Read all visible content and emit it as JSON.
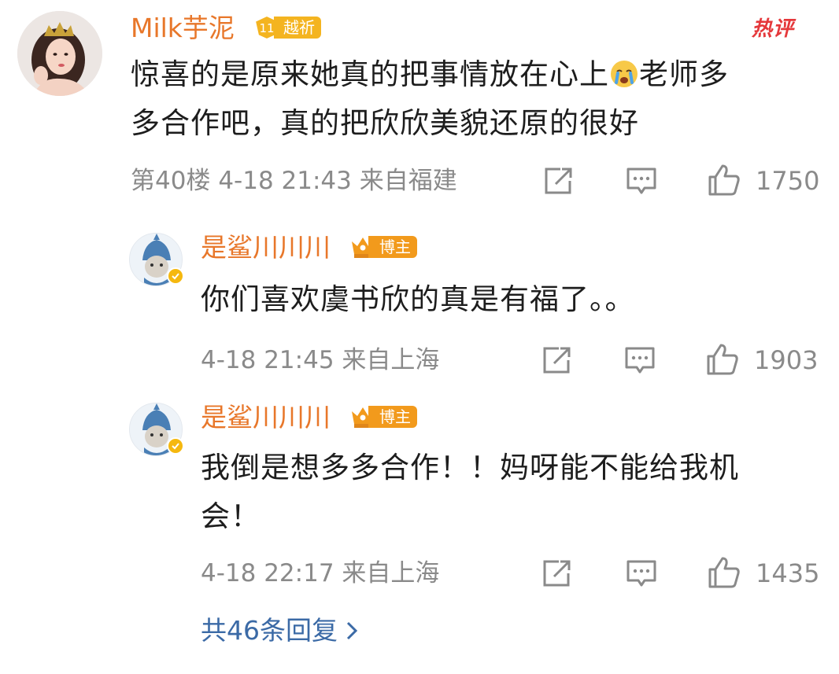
{
  "hot_tag": "热评",
  "main_comment": {
    "username": "Milk芋泥",
    "level_number": "11",
    "level_label": "越祈",
    "text_line1": "惊喜的是原来她真的把事情放在心上",
    "emoji": "crying-face-emoji",
    "text_line1_tail": "老师多",
    "text_line2": "多合作吧，真的把欣欣美貌还原的很好",
    "floor": "第40楼",
    "time": "4-18 21:43",
    "location": "来自福建",
    "likes": "1750"
  },
  "replies": [
    {
      "username": "是鲨川川川",
      "badge": "博主",
      "text_line1": "你们喜欢虞书欣的真是有福了。。",
      "text_line2": "",
      "time": "4-18 21:45",
      "location": "来自上海",
      "likes": "1903"
    },
    {
      "username": "是鲨川川川",
      "badge": "博主",
      "text_line1": "我倒是想多多合作！！妈呀能不能给我机",
      "text_line2": "会！",
      "time": "4-18 22:17",
      "location": "来自上海",
      "likes": "1435"
    }
  ],
  "more_replies_label": "共46条回复",
  "colors": {
    "username": "#e8772a",
    "meta": "#8a8a8a",
    "link": "#3b6aa6",
    "hot": "#e5383b",
    "level_badge": "#f4b420",
    "host_badge": "#f29a1c"
  }
}
